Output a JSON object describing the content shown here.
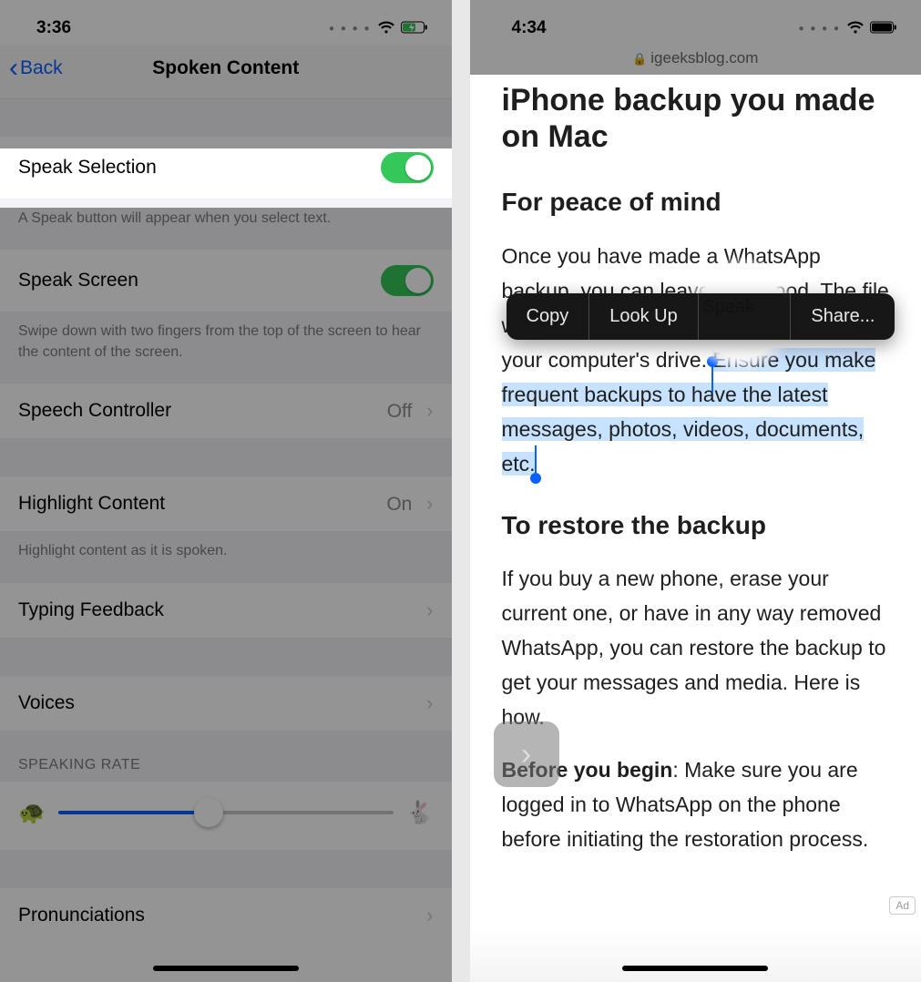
{
  "colors": {
    "accent": "#0a60ff",
    "switch_on": "#34c759",
    "selection": "rgba(0,122,255,0.22)"
  },
  "left": {
    "status": {
      "time": "3:36"
    },
    "nav": {
      "back": "Back",
      "title": "Spoken Content"
    },
    "cells": {
      "speak_selection": {
        "label": "Speak Selection",
        "on": true
      },
      "speak_selection_footer": "A Speak button will appear when you select text.",
      "speak_screen": {
        "label": "Speak Screen",
        "on": true
      },
      "speak_screen_footer": "Swipe down with two fingers from the top of the screen to hear the content of the screen.",
      "speech_controller": {
        "label": "Speech Controller",
        "value": "Off"
      },
      "highlight_content": {
        "label": "Highlight Content",
        "value": "On"
      },
      "highlight_footer": "Highlight content as it is spoken.",
      "typing_feedback": {
        "label": "Typing Feedback"
      },
      "voices": {
        "label": "Voices"
      },
      "rate_header": "SPEAKING RATE",
      "pronunciations": {
        "label": "Pronunciations"
      }
    },
    "slider": {
      "value_percent": 45
    }
  },
  "right": {
    "status": {
      "time": "4:34"
    },
    "address": {
      "host": "igeeksblog.com"
    },
    "article": {
      "title_partial": "iPhone backup you made on Mac",
      "h2_1": "For peace of mind",
      "p1_pre": "Once you have made a WhatsApp backup, you can leave it for good. The file will always remain saved safely locally on your computer's drive. ",
      "p1_sel": "Ensure you make frequent backups to have the latest messages, photos, videos, documents, etc.",
      "h2_2": "To restore the backup",
      "p2": "If you buy a new phone, erase your current one, or have in any way removed WhatsApp, you can restore the backup to get your messages and media. Here is how.",
      "p3_strong": "Before you begin",
      "p3_rest": ": Make sure you are logged in to WhatsApp on the phone before initiating the restoration process."
    },
    "callout": {
      "copy": "Copy",
      "lookup": "Look Up",
      "speak": "Speak",
      "share": "Share..."
    },
    "ad_label": "Ad"
  }
}
